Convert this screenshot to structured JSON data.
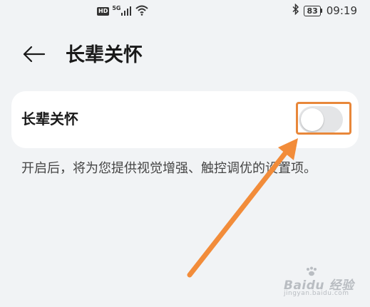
{
  "status_bar": {
    "hd_badge": "HD",
    "network": "5G",
    "icons": [
      "signal-icon",
      "wifi-icon",
      "bluetooth-icon"
    ],
    "battery": "83",
    "time": "09:19"
  },
  "header": {
    "back_icon": "back-arrow-icon",
    "title": "长辈关怀"
  },
  "setting": {
    "label": "长辈关怀",
    "toggle_state": "off"
  },
  "description": "开启后，将为您提供视觉增强、触控调优的设置项。",
  "annotation": {
    "color": "#e8873a",
    "shapes": [
      "highlight-box",
      "pointer-arrow"
    ]
  },
  "watermark": {
    "text": "Baidu 经验",
    "sub": "jingyan.baidu.com"
  }
}
